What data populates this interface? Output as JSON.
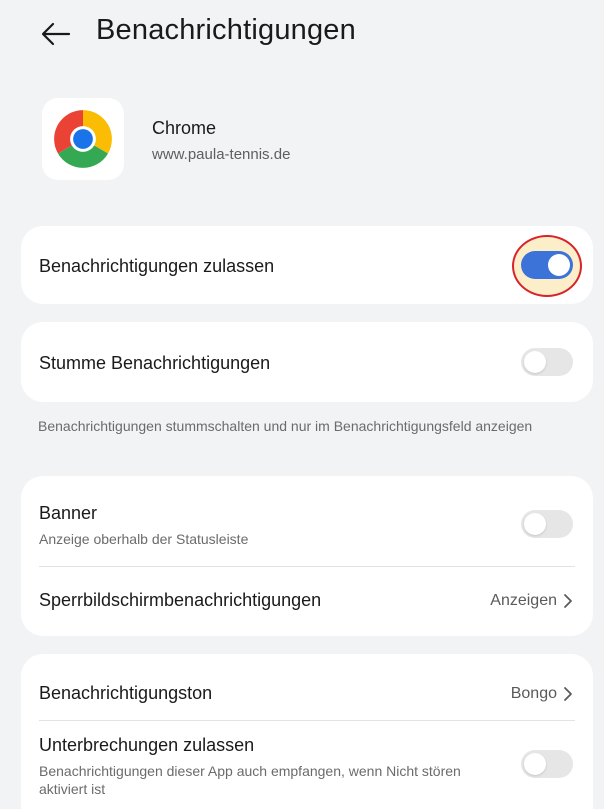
{
  "header": {
    "title": "Benachrichtigungen",
    "back_icon": "arrow-left-icon"
  },
  "app": {
    "name": "Chrome",
    "url": "www.paula-tennis.de",
    "icon": "chrome-icon"
  },
  "allow_notifications": {
    "label": "Benachrichtigungen zulassen",
    "enabled": true
  },
  "silent_notifications": {
    "label": "Stumme Benachrichtigungen",
    "enabled": false,
    "helper": "Benachrichtigungen stummschalten und nur im Benachrichtigungsfeld anzeigen"
  },
  "banner": {
    "label": "Banner",
    "sub": "Anzeige oberhalb der Statusleiste",
    "enabled": false
  },
  "lockscreen": {
    "label": "Sperrbildschirmbenachrichtigungen",
    "value": "Anzeigen"
  },
  "tone": {
    "label": "Benachrichtigungston",
    "value": "Bongo"
  },
  "interruptions": {
    "label": "Unterbrechungen zulassen",
    "sub": "Benachrichtigungen dieser App auch empfangen, wenn Nicht stören aktiviert ist",
    "enabled": false
  },
  "colors": {
    "accent": "#3b73d9",
    "highlight_ring": "#d8232a",
    "highlight_fill": "#fbeec8"
  }
}
